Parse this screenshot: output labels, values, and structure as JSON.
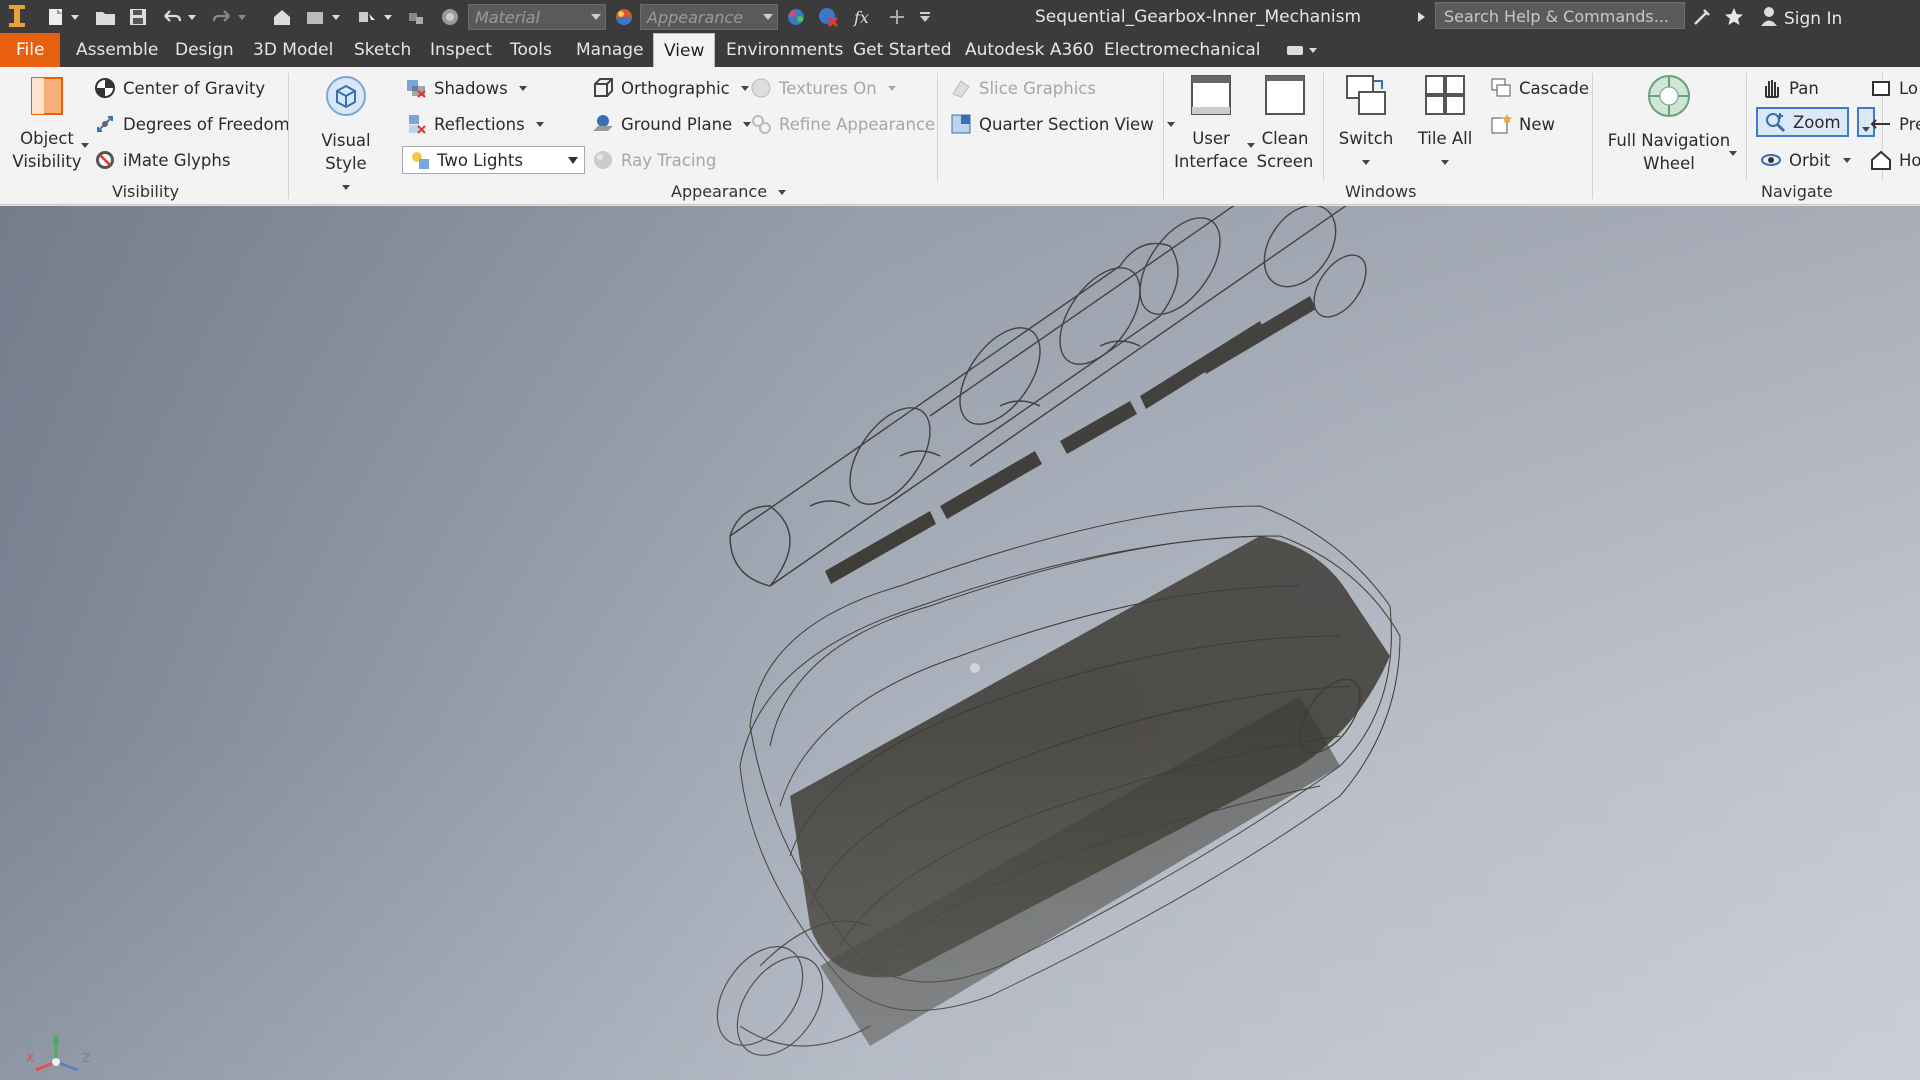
{
  "window": {
    "title": "Sequential_Gearbox-Inner_Mechanism"
  },
  "quick_access": {
    "material_placeholder": "Material",
    "appearance_placeholder": "Appearance",
    "search_placeholder": "Search Help & Commands...",
    "sign_in": "Sign In"
  },
  "tabs": [
    "File",
    "Assemble",
    "Design",
    "3D Model",
    "Sketch",
    "Inspect",
    "Tools",
    "Manage",
    "View",
    "Environments",
    "Get Started",
    "Autodesk A360",
    "Electromechanical"
  ],
  "active_tab": "View",
  "ribbon": {
    "visibility": {
      "title": "Visibility",
      "object_visibility_1": "Object",
      "object_visibility_2": "Visibility",
      "center_of_gravity": "Center of Gravity",
      "degrees_of_freedom": "Degrees of Freedom",
      "imate_glyphs": "iMate Glyphs"
    },
    "appearance": {
      "title": "Appearance",
      "visual_style": "Visual Style",
      "shadows": "Shadows",
      "reflections": "Reflections",
      "lighting_value": "Two Lights",
      "orthographic": "Orthographic",
      "ground_plane": "Ground Plane",
      "ray_tracing": "Ray Tracing",
      "textures_on": "Textures On",
      "refine_appearance": "Refine Appearance",
      "slice_graphics": "Slice Graphics",
      "quarter_section_view": "Quarter Section View"
    },
    "windows": {
      "title": "Windows",
      "user_interface_1": "User",
      "user_interface_2": "Interface",
      "clean_screen_1": "Clean",
      "clean_screen_2": "Screen",
      "switch": "Switch",
      "tile_all": "Tile All",
      "cascade": "Cascade",
      "new": "New"
    },
    "navigate": {
      "title": "Navigate",
      "full_nav_wheel_1": "Full Navigation",
      "full_nav_wheel_2": "Wheel",
      "pan": "Pan",
      "zoom": "Zoom",
      "orbit": "Orbit",
      "look_at_partial": "Lo",
      "previous_partial": "Pre",
      "home_partial": "Ho"
    }
  },
  "viewport": {
    "background_top": "#7b8594",
    "background_right": "#c2c6cf",
    "wireframe_color": "#3d3a33",
    "triad": {
      "x": "X",
      "y": "Y",
      "z": "Z"
    }
  }
}
